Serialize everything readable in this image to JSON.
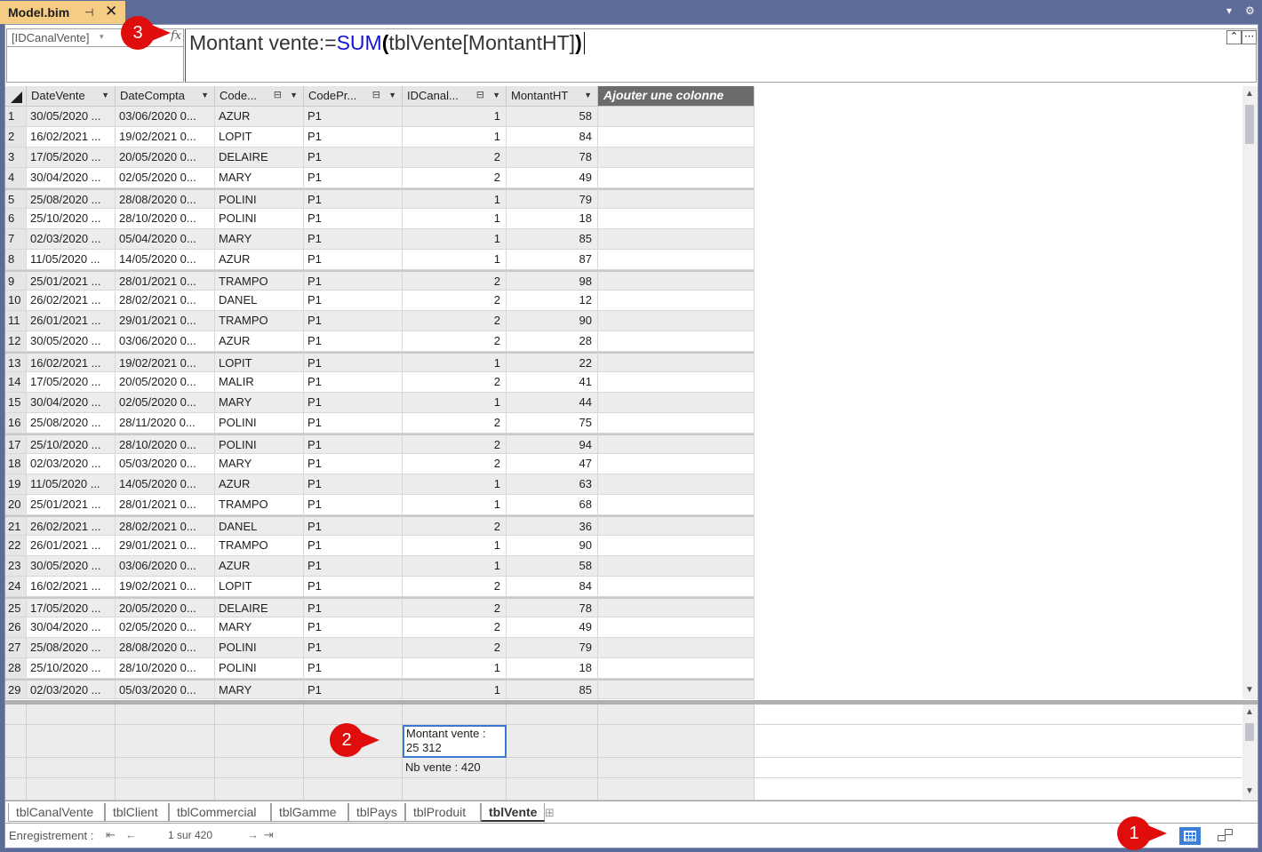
{
  "doc_tab": {
    "title": "Model.bim",
    "pin_glyph": "⊣",
    "close_glyph": "✕"
  },
  "formula_bar": {
    "name_box": "[IDCanalVente]",
    "fx": "fx",
    "formula_prefix": "Montant vente:=",
    "formula_func": "SUM",
    "formula_open": "(",
    "formula_arg": "tblVente[MontantHT]",
    "formula_close": ")",
    "expand_glyph": "⌃",
    "more_glyph": "⋯"
  },
  "columns": [
    {
      "name": "DateVente",
      "width": 100,
      "relation": false
    },
    {
      "name": "DateCompta",
      "width": 112,
      "relation": false
    },
    {
      "name": "Code...",
      "width": 100,
      "relation": true
    },
    {
      "name": "CodePr...",
      "width": 111,
      "relation": true
    },
    {
      "name": "IDCanal...",
      "width": 117,
      "relation": true,
      "numeric": true
    },
    {
      "name": "MontantHT",
      "width": 103,
      "relation": false,
      "numeric": true
    }
  ],
  "add_column_label": "Ajouter une colonne",
  "rows": [
    [
      "1",
      "30/05/2020 ...",
      "03/06/2020 0...",
      "AZUR",
      "P1",
      "1",
      "58"
    ],
    [
      "2",
      "16/02/2021 ...",
      "19/02/2021 0...",
      "LOPIT",
      "P1",
      "1",
      "84"
    ],
    [
      "3",
      "17/05/2020 ...",
      "20/05/2020 0...",
      "DELAIRE",
      "P1",
      "2",
      "78"
    ],
    [
      "4",
      "30/04/2020 ...",
      "02/05/2020 0...",
      "MARY",
      "P1",
      "2",
      "49"
    ],
    [
      "5",
      "25/08/2020 ...",
      "28/08/2020 0...",
      "POLINI",
      "P1",
      "1",
      "79"
    ],
    [
      "6",
      "25/10/2020 ...",
      "28/10/2020 0...",
      "POLINI",
      "P1",
      "1",
      "18"
    ],
    [
      "7",
      "02/03/2020 ...",
      "05/04/2020 0...",
      "MARY",
      "P1",
      "1",
      "85"
    ],
    [
      "8",
      "11/05/2020 ...",
      "14/05/2020 0...",
      "AZUR",
      "P1",
      "1",
      "87"
    ],
    [
      "9",
      "25/01/2021 ...",
      "28/01/2021 0...",
      "TRAMPO",
      "P1",
      "2",
      "98"
    ],
    [
      "10",
      "26/02/2021 ...",
      "28/02/2021 0...",
      "DANEL",
      "P1",
      "2",
      "12"
    ],
    [
      "11",
      "26/01/2021 ...",
      "29/01/2021 0...",
      "TRAMPO",
      "P1",
      "2",
      "90"
    ],
    [
      "12",
      "30/05/2020 ...",
      "03/06/2020 0...",
      "AZUR",
      "P1",
      "2",
      "28"
    ],
    [
      "13",
      "16/02/2021 ...",
      "19/02/2021 0...",
      "LOPIT",
      "P1",
      "1",
      "22"
    ],
    [
      "14",
      "17/05/2020 ...",
      "20/05/2020 0...",
      "MALIR",
      "P1",
      "2",
      "41"
    ],
    [
      "15",
      "30/04/2020 ...",
      "02/05/2020 0...",
      "MARY",
      "P1",
      "1",
      "44"
    ],
    [
      "16",
      "25/08/2020 ...",
      "28/11/2020 0...",
      "POLINI",
      "P1",
      "2",
      "75"
    ],
    [
      "17",
      "25/10/2020 ...",
      "28/10/2020 0...",
      "POLINI",
      "P1",
      "2",
      "94"
    ],
    [
      "18",
      "02/03/2020 ...",
      "05/03/2020 0...",
      "MARY",
      "P1",
      "2",
      "47"
    ],
    [
      "19",
      "11/05/2020 ...",
      "14/05/2020 0...",
      "AZUR",
      "P1",
      "1",
      "63"
    ],
    [
      "20",
      "25/01/2021 ...",
      "28/01/2021 0...",
      "TRAMPO",
      "P1",
      "1",
      "68"
    ],
    [
      "21",
      "26/02/2021 ...",
      "28/02/2021 0...",
      "DANEL",
      "P1",
      "2",
      "36"
    ],
    [
      "22",
      "26/01/2021 ...",
      "29/01/2021 0...",
      "TRAMPO",
      "P1",
      "1",
      "90"
    ],
    [
      "23",
      "30/05/2020 ...",
      "03/06/2020 0...",
      "AZUR",
      "P1",
      "1",
      "58"
    ],
    [
      "24",
      "16/02/2021 ...",
      "19/02/2021 0...",
      "LOPIT",
      "P1",
      "2",
      "84"
    ],
    [
      "25",
      "17/05/2020 ...",
      "20/05/2020 0...",
      "DELAIRE",
      "P1",
      "2",
      "78"
    ],
    [
      "26",
      "30/04/2020 ...",
      "02/05/2020 0...",
      "MARY",
      "P1",
      "2",
      "49"
    ],
    [
      "27",
      "25/08/2020 ...",
      "28/08/2020 0...",
      "POLINI",
      "P1",
      "2",
      "79"
    ],
    [
      "28",
      "25/10/2020 ...",
      "28/10/2020 0...",
      "POLINI",
      "P1",
      "1",
      "18"
    ],
    [
      "29",
      "02/03/2020 ...",
      "05/03/2020 0...",
      "MARY",
      "P1",
      "1",
      "85"
    ]
  ],
  "measures": {
    "montant_line1": "Montant vente :",
    "montant_line2": "25 312",
    "nb_vente": "Nb vente : 420"
  },
  "sheet_tabs": [
    "tblCanalVente",
    "tblClient",
    "tblCommercial",
    "tblGamme",
    "tblPays",
    "tblProduit",
    "tblVente"
  ],
  "active_sheet": "tblVente",
  "status": {
    "label": "Enregistrement :",
    "position": "1 sur 420",
    "first_glyph": "⇤",
    "prev_glyph": "←",
    "next_glyph": "→",
    "last_glyph": "⇥"
  },
  "callouts": [
    "1",
    "2",
    "3"
  ],
  "colors": {
    "title_bar": "#5d6b99",
    "active_tab": "#f5cc84",
    "callout": "#e00d0d",
    "selection": "#3a78d6"
  }
}
